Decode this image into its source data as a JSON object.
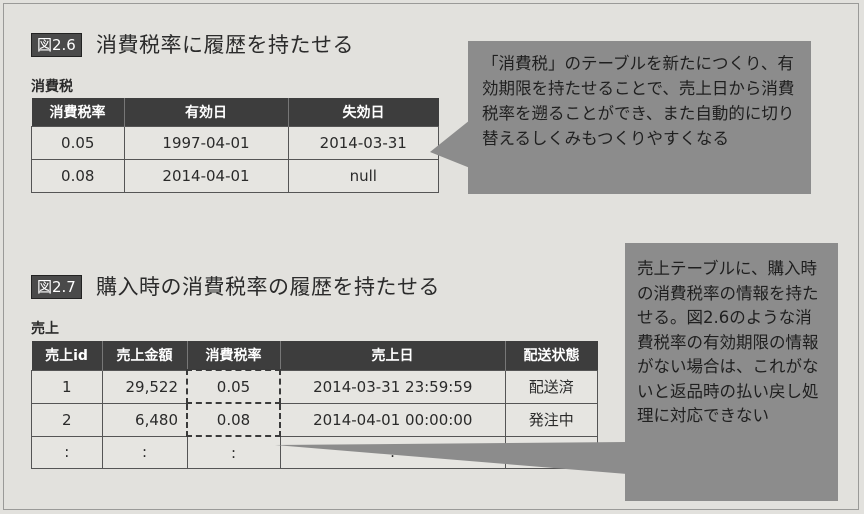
{
  "fig1": {
    "tag": "図2.6",
    "title": "消費税率に履歴を持たせる",
    "table_name": "消費税",
    "headers": [
      "消費税率",
      "有効日",
      "失効日"
    ],
    "rows": [
      [
        "0.05",
        "1997-04-01",
        "2014-03-31"
      ],
      [
        "0.08",
        "2014-04-01",
        "null"
      ]
    ],
    "callout": "「消費税」のテーブルを新たにつくり、有効期限を持たせることで、売上日から消費税率を遡ることができ、また自動的に切り替えるしくみもつくりやすくなる"
  },
  "fig2": {
    "tag": "図2.7",
    "title": "購入時の消費税率の履歴を持たせる",
    "table_name": "売上",
    "headers": [
      "売上id",
      "売上金額",
      "消費税率",
      "売上日",
      "配送状態"
    ],
    "rows": [
      [
        "1",
        "29,522",
        "0.05",
        "2014-03-31 23:59:59",
        "配送済"
      ],
      [
        "2",
        "6,480",
        "0.08",
        "2014-04-01 00:00:00",
        "発注中"
      ],
      [
        ":",
        ":",
        ":",
        ":",
        ""
      ]
    ],
    "callout": "売上テーブルに、購入時の消費税率の情報を持たせる。図2.6のような消費税率の有効期限の情報がない場合は、これがないと返品時の払い戻し処理に対応できない"
  }
}
